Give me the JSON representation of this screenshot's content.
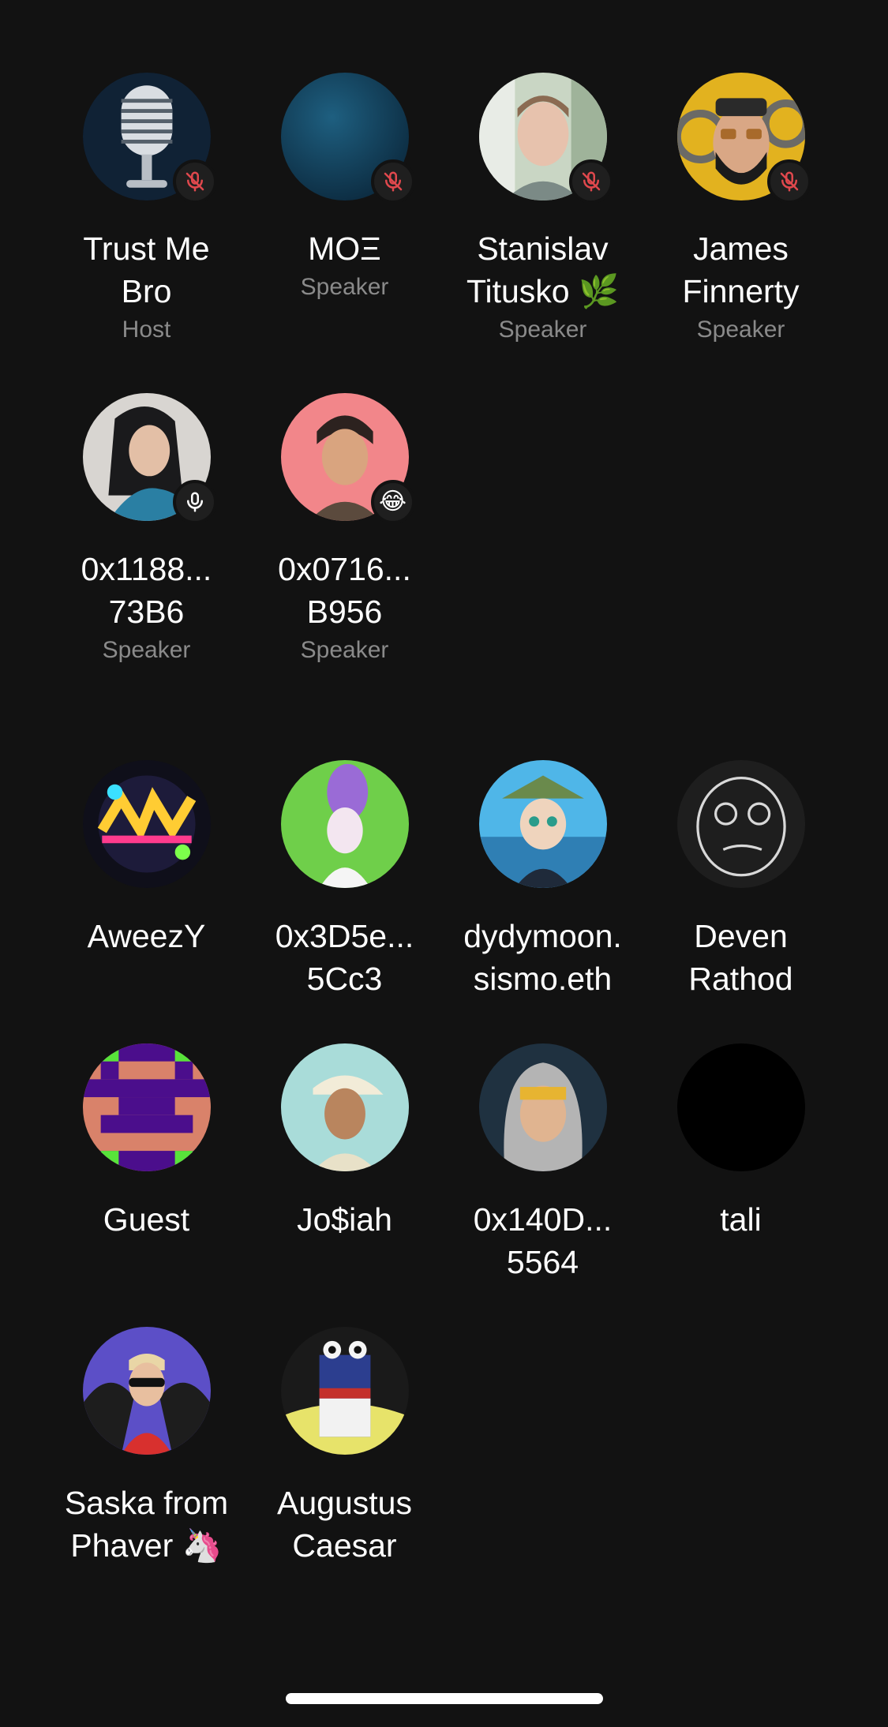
{
  "speakers": [
    {
      "name": "Trust Me\nBro",
      "role": "Host",
      "badge": "muted-mic-icon",
      "avatar": "microphone-avatar"
    },
    {
      "name": "MOΞ",
      "role": "Speaker",
      "badge": "muted-mic-icon",
      "avatar": "blue-gradient-avatar"
    },
    {
      "name": "Stanislav\nTitusko 🌿",
      "role": "Speaker",
      "badge": "muted-mic-icon",
      "avatar": "man-photo-avatar"
    },
    {
      "name": "James\nFinnerty",
      "role": "Speaker",
      "badge": "muted-mic-icon",
      "avatar": "bearded-man-avatar"
    },
    {
      "name": "0x1188...\n73B6",
      "role": "Speaker",
      "badge": "mic-icon",
      "avatar": "woman-photo-avatar"
    },
    {
      "name": "0x0716...\nB956",
      "role": "Speaker",
      "badge": "😂",
      "avatar": "anime-man-avatar"
    }
  ],
  "listeners": [
    {
      "name": "AweezY",
      "avatar": "graffiti-logo-avatar"
    },
    {
      "name": "0x3D5e...\n5Cc3",
      "avatar": "purple-hair-avatar"
    },
    {
      "name": "dydymoon.\nsismo.eth",
      "avatar": "anime-hat-avatar"
    },
    {
      "name": "Deven\nRathod",
      "avatar": "sketch-face-avatar"
    },
    {
      "name": "Guest",
      "avatar": "pixel-pattern-avatar"
    },
    {
      "name": "Jo$iah",
      "avatar": "cap-man-avatar"
    },
    {
      "name": "0x140D...\n5564",
      "avatar": "hooded-man-avatar"
    },
    {
      "name": "tali",
      "avatar": "black-avatar"
    },
    {
      "name": "Saska from\nPhaver 🦄",
      "avatar": "sunglasses-man-avatar"
    },
    {
      "name": "Augustus\nCaesar",
      "avatar": "cigarette-pack-avatar"
    }
  ],
  "colors": {
    "background": "#121212",
    "muted_red": "#e0484d",
    "secondary_text": "#8a8a8a"
  }
}
